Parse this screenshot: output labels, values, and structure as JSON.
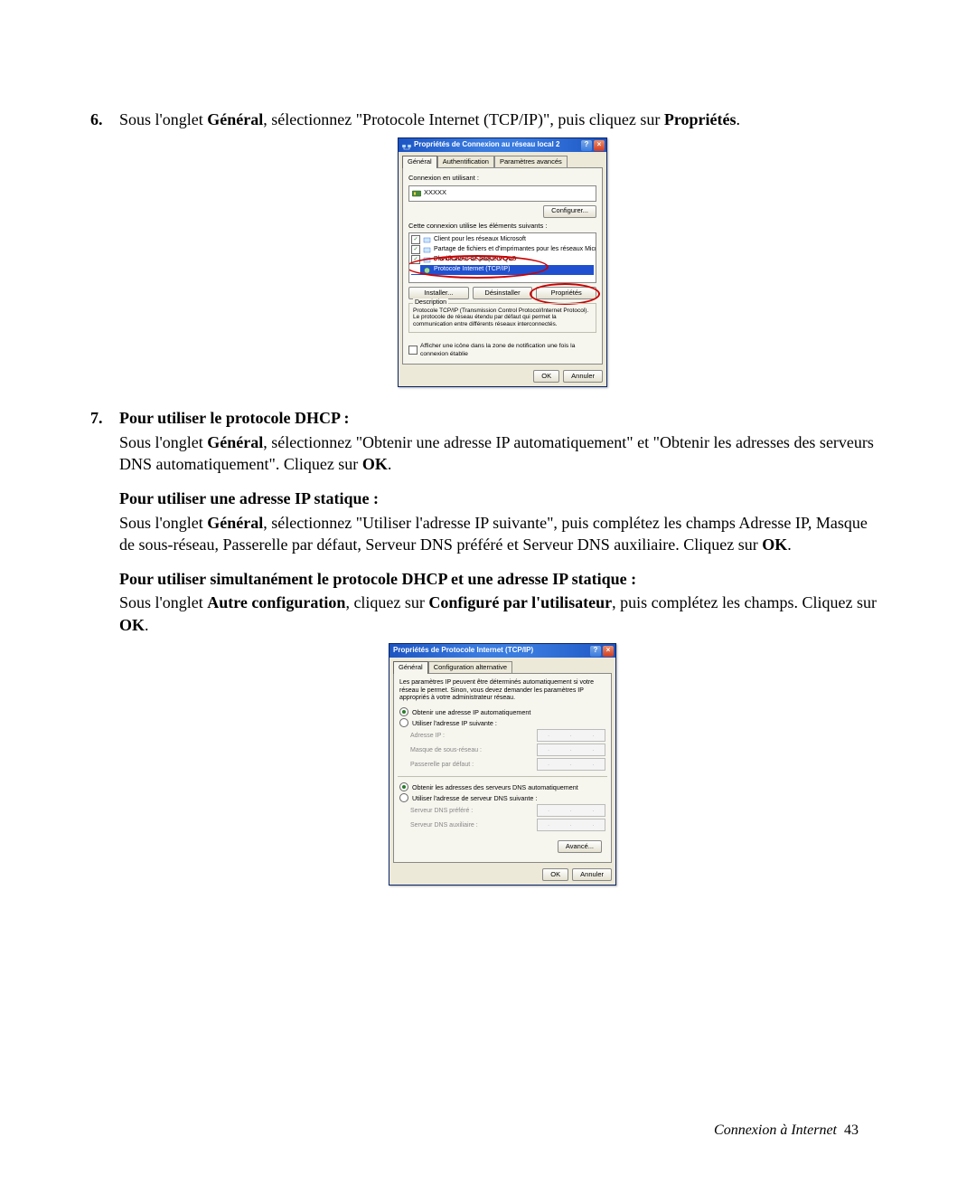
{
  "steps": {
    "six": {
      "num": "6.",
      "body_before": "Sous l'onglet ",
      "bold1": "Général",
      "body_mid": ", sélectionnez \"Protocole Internet (TCP/IP)\", puis cliquez sur ",
      "bold2": "Propriétés",
      "body_after": "."
    },
    "seven": {
      "num": "7.",
      "dhcp_title": "Pour utiliser le protocole DHCP :",
      "dhcp_body_before": "Sous l'onglet ",
      "dhcp_bold1": "Général",
      "dhcp_body_mid": ", sélectionnez \"Obtenir une adresse IP automatiquement\" et \"Obtenir les adresses des serveurs DNS automatiquement\". Cliquez sur ",
      "dhcp_bold2": "OK",
      "dhcp_body_after": ".",
      "static_title": "Pour utiliser une adresse IP statique :",
      "static_body_before": "Sous l'onglet ",
      "static_bold1": "Général",
      "static_body_mid": ", sélectionnez \"Utiliser l'adresse IP suivante\", puis complétez les champs Adresse IP, Masque de sous-réseau, Passerelle par défaut, Serveur DNS préféré et Serveur DNS auxiliaire. Cliquez sur ",
      "static_bold2": "OK",
      "static_body_after": ".",
      "both_title": "Pour utiliser simultanément le protocole DHCP et une adresse IP statique :",
      "both_body_before": "Sous l'onglet ",
      "both_bold1": "Autre configuration",
      "both_body_mid": ", cliquez sur ",
      "both_bold2": "Configuré par l'utilisateur",
      "both_body_mid2": ", puis complétez les champs. Cliquez sur ",
      "both_bold3": "OK",
      "both_body_after": "."
    }
  },
  "dlg1": {
    "title": "Propriétés de Connexion au réseau local 2",
    "help_btn": "?",
    "close_btn": "×",
    "tabs": [
      "Général",
      "Authentification",
      "Paramètres avancés"
    ],
    "active_tab": 0,
    "conn_label": "Connexion en utilisant :",
    "conn_value": "XXXXX",
    "configure_btn": "Configurer...",
    "elements_label": "Cette connexion utilise les éléments suivants :",
    "elements": [
      {
        "label": "Client pour les réseaux Microsoft",
        "checked": true
      },
      {
        "label": "Partage de fichiers et d'imprimantes pour les réseaux Microsoft",
        "checked": true
      },
      {
        "label": "Planificateur de paquets QoS",
        "checked": true
      },
      {
        "label": "Protocole Internet (TCP/IP)",
        "checked": true,
        "selected": true
      }
    ],
    "install_btn": "Installer...",
    "uninstall_btn": "Désinstaller",
    "props_btn": "Propriétés",
    "desc_legend": "Description",
    "desc_text": "Protocole TCP/IP (Transmission Control Protocol/Internet Protocol). Le protocole de réseau étendu par défaut qui permet la communication entre différents réseaux interconnectés.",
    "notify_label": "Afficher une icône dans la zone de notification une fois la connexion établie",
    "ok_btn": "OK",
    "cancel_btn": "Annuler"
  },
  "dlg2": {
    "title": "Propriétés de Protocole Internet (TCP/IP)",
    "help_btn": "?",
    "close_btn": "×",
    "tabs": [
      "Général",
      "Configuration alternative"
    ],
    "active_tab": 0,
    "intro": "Les paramètres IP peuvent être déterminés automatiquement si votre réseau le permet. Sinon, vous devez demander les paramètres IP appropriés à votre administrateur réseau.",
    "radio_auto_ip": "Obtenir une adresse IP automatiquement",
    "radio_static_ip": "Utiliser l'adresse IP suivante :",
    "ip_label": "Adresse IP :",
    "mask_label": "Masque de sous-réseau :",
    "gw_label": "Passerelle par défaut :",
    "radio_auto_dns": "Obtenir les adresses des serveurs DNS automatiquement",
    "radio_static_dns": "Utiliser l'adresse de serveur DNS suivante :",
    "dns1_label": "Serveur DNS préféré :",
    "dns2_label": "Serveur DNS auxiliaire :",
    "adv_btn": "Avancé...",
    "ok_btn": "OK",
    "cancel_btn": "Annuler"
  },
  "footer": {
    "text": "Connexion à Internet",
    "page": "43"
  }
}
